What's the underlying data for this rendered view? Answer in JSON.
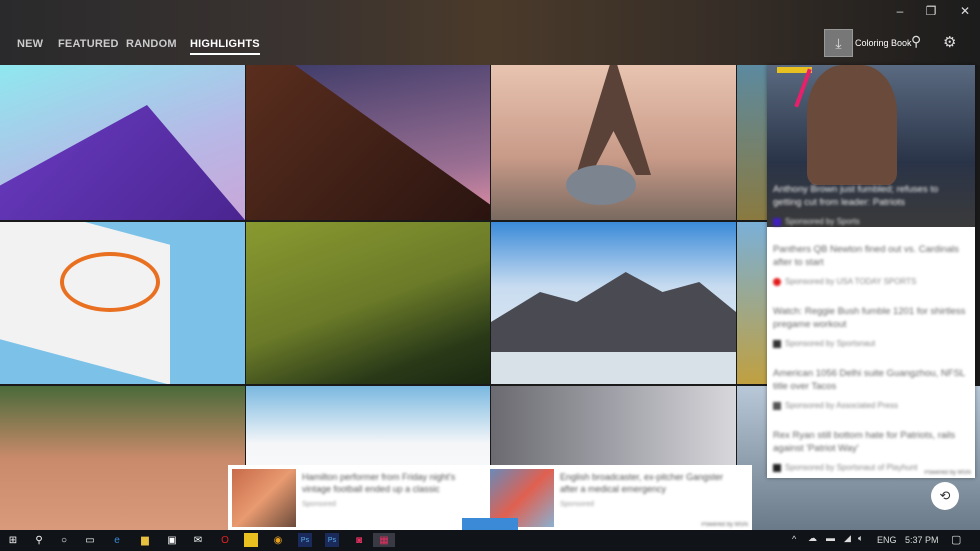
{
  "header": {
    "tabs": [
      {
        "label": "NEW"
      },
      {
        "label": "FEATURED"
      },
      {
        "label": "RANDOM"
      },
      {
        "label": "HIGHLIGHTS",
        "active": true
      }
    ],
    "coloring_book_label": "Coloring Book",
    "icons": [
      "download-icon",
      "search-icon",
      "gear-icon",
      "minimize-icon",
      "restore-icon",
      "close-icon"
    ]
  },
  "ads": {
    "featured": {
      "title": "Anthony Brown just fumbled; refuses to getting cut from leader: Patriots",
      "sponsor": "Sponsored by Sports"
    },
    "items": [
      {
        "title": "Panthers QB Newton fined out vs. Cardinals after to start",
        "sponsor": "Sponsored by USA TODAY SPORTS",
        "color": "#e21b1b"
      },
      {
        "title": "Watch: Reggie Bush fumble 1201 for shirtless pregame workout",
        "sponsor": "Sponsored by Sportsnaut",
        "color": "#333333"
      },
      {
        "title": "American 1056 Delhi suite Guangzhou, NFSL title over Tacos",
        "sponsor": "Sponsored by Associated Press",
        "color": "#555555"
      },
      {
        "title": "Rex Ryan still bottom hate for Patriots, rails against 'Patriot Way'",
        "sponsor": "Sponsored by Sportsnaut of Playhunt",
        "color": "#222222"
      }
    ],
    "powered_by": "Powered by MSN",
    "bottom": [
      {
        "title": "Hamilton performer from Friday night's vintage football ended up a classic",
        "sponsor": "Sponsored"
      },
      {
        "title": "English broadcaster, ex-pitcher Gangster after a medical emergency",
        "sponsor": "Sponsored"
      }
    ],
    "bottom_powered": "Powered by MSN"
  },
  "taskbar": {
    "language": "ENG",
    "time": "5:37 PM"
  }
}
